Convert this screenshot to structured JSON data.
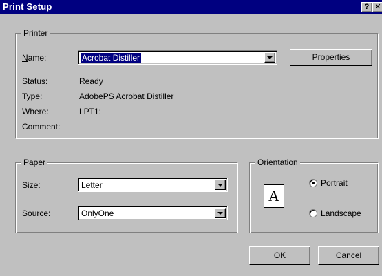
{
  "window": {
    "title": "Print Setup",
    "help_glyph": "?",
    "close_glyph": "✕"
  },
  "printer": {
    "group_label": "Printer",
    "name_label_pre": "",
    "name_label_hot": "N",
    "name_label_post": "ame:",
    "name_value": "Acrobat Distiller",
    "properties_pre": "",
    "properties_hot": "P",
    "properties_post": "roperties",
    "status_label": "Status:",
    "status_value": "Ready",
    "type_label": "Type:",
    "type_value": "AdobePS Acrobat Distiller",
    "where_label": "Where:",
    "where_value": "LPT1:",
    "comment_label": "Comment:",
    "comment_value": ""
  },
  "paper": {
    "group_label": "Paper",
    "size_label_pre": "Si",
    "size_label_hot": "z",
    "size_label_post": "e:",
    "size_value": "Letter",
    "source_label_pre": "",
    "source_label_hot": "S",
    "source_label_post": "ource:",
    "source_value": "OnlyOne"
  },
  "orientation": {
    "group_label": "Orientation",
    "icon_letter": "A",
    "portrait_pre": "P",
    "portrait_hot": "o",
    "portrait_post": "rtrait",
    "portrait_selected": true,
    "landscape_pre": "",
    "landscape_hot": "L",
    "landscape_post": "andscape",
    "landscape_selected": false
  },
  "buttons": {
    "ok": "OK",
    "cancel": "Cancel"
  }
}
